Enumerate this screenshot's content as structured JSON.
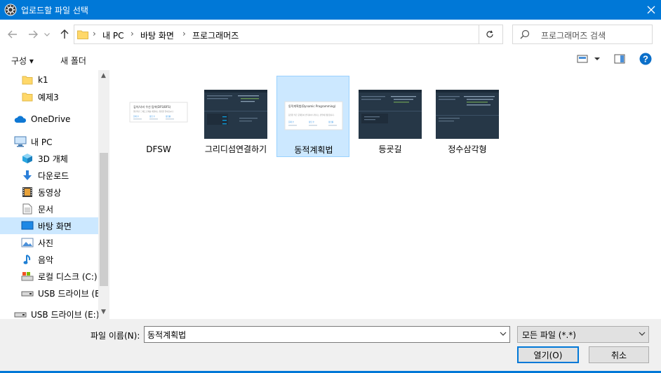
{
  "window": {
    "title": "업로드할 파일 선택"
  },
  "address": {
    "crumbs": [
      "내 PC",
      "바탕 화면",
      "프로그래머즈"
    ],
    "search_placeholder": "프로그래머즈 검색"
  },
  "toolbar": {
    "organize": "구성 ▾",
    "new_folder": "새 폴더"
  },
  "sidebar": {
    "items": [
      {
        "label": "k1",
        "icon": "folder-icon"
      },
      {
        "label": "예제3",
        "icon": "folder-icon"
      },
      {
        "label": "OneDrive",
        "icon": "cloud-icon"
      },
      {
        "label": "내 PC",
        "icon": "computer-icon"
      },
      {
        "label": "3D 개체",
        "icon": "cube-icon"
      },
      {
        "label": "다운로드",
        "icon": "download-icon"
      },
      {
        "label": "동영상",
        "icon": "video-icon"
      },
      {
        "label": "문서",
        "icon": "document-icon"
      },
      {
        "label": "바탕 화면",
        "icon": "desktop-icon",
        "selected": true
      },
      {
        "label": "사진",
        "icon": "picture-icon"
      },
      {
        "label": "음악",
        "icon": "music-icon"
      },
      {
        "label": "로컬 디스크 (C:)",
        "icon": "drive-icon"
      },
      {
        "label": "USB 드라이브 (E",
        "icon": "usb-drive-icon"
      },
      {
        "label": "USB 드라이브 (E:)",
        "icon": "usb-drive-icon"
      }
    ]
  },
  "files": [
    {
      "name": "DFSW",
      "thumb": "light-dfs",
      "thumb_title": "깊이/너비 우선 탐색(DFS/BFS)",
      "thumb_text": "일반적인 그래프 문제를 해결하는 방법을 알아봅시다.",
      "cols": [
        "문제 수",
        "정답 수",
        "정답률"
      ]
    },
    {
      "name": "그리디섬연결하기",
      "thumb": "dark-code"
    },
    {
      "name": "동적계획법",
      "thumb": "light-dp",
      "selected": true,
      "thumb_title": "동적계획법(Dynamic Programming)",
      "thumb_text": "동일한 작은 문제들이 반복하여 나타나는 경우에 유용합니다.",
      "cols": [
        "문제 수",
        "정답 수",
        "정답률"
      ]
    },
    {
      "name": "등굣길",
      "thumb": "dark-code"
    },
    {
      "name": "정수삼각형",
      "thumb": "dark-code"
    }
  ],
  "bottom": {
    "filename_label": "파일 이름(N):",
    "filename_value": "동적계획법",
    "filter": "모든 파일 (*.*)",
    "open_button": "열기(O)",
    "cancel_button": "취소"
  },
  "colors": {
    "accent": "#0078d7",
    "selection": "#cce8ff",
    "folder": "#ffd869"
  }
}
